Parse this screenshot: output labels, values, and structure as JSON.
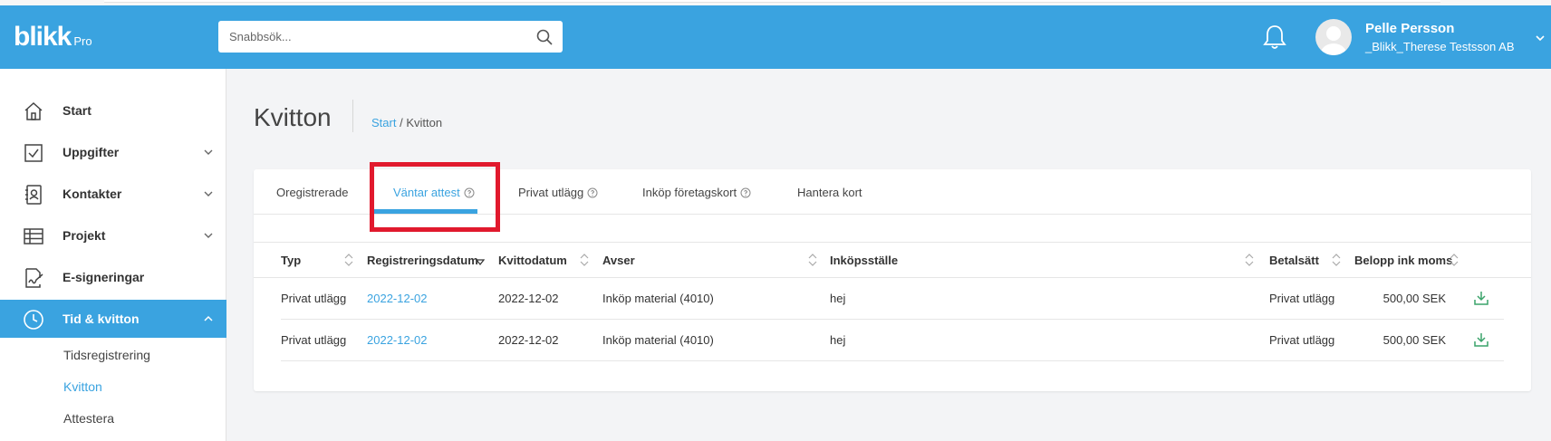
{
  "header": {
    "logo_text": "blikk",
    "logo_suffix": "Pro",
    "search_placeholder": "Snabbsök...",
    "user_name": "Pelle Persson",
    "user_company": "_Blikk_Therese Testsson AB"
  },
  "sidebar": {
    "items": [
      {
        "label": "Start",
        "icon": "home-icon"
      },
      {
        "label": "Uppgifter",
        "icon": "checkbox-icon"
      },
      {
        "label": "Kontakter",
        "icon": "contacts-icon"
      },
      {
        "label": "Projekt",
        "icon": "table-icon"
      },
      {
        "label": "E-signeringar",
        "icon": "signature-icon"
      },
      {
        "label": "Tid & kvitton",
        "icon": "clock-icon"
      }
    ],
    "sub_items": [
      {
        "label": "Tidsregistrering"
      },
      {
        "label": "Kvitton"
      },
      {
        "label": "Attestera"
      }
    ]
  },
  "page": {
    "title": "Kvitton",
    "breadcrumb_link": "Start",
    "breadcrumb_sep": "/",
    "breadcrumb_current": "Kvitton"
  },
  "tabs": [
    {
      "label": "Oregistrerade"
    },
    {
      "label": "Väntar attest"
    },
    {
      "label": "Privat utlägg"
    },
    {
      "label": "Inköp företagskort"
    },
    {
      "label": "Hantera kort"
    }
  ],
  "table": {
    "columns": [
      "Typ",
      "Registreringsdatum",
      "Kvittodatum",
      "Avser",
      "Inköpsställe",
      "Betalsätt",
      "Belopp ink moms"
    ],
    "rows": [
      {
        "typ": "Privat utlägg",
        "reg_date": "2022-12-02",
        "kvitto_date": "2022-12-02",
        "avser": "Inköp material (4010)",
        "inkopsstalle": "hej",
        "betalsatt": "Privat utlägg",
        "belopp": "500,00 SEK"
      },
      {
        "typ": "Privat utlägg",
        "reg_date": "2022-12-02",
        "kvitto_date": "2022-12-02",
        "avser": "Inköp material (4010)",
        "inkopsstalle": "hej",
        "betalsatt": "Privat utlägg",
        "belopp": "500,00 SEK"
      }
    ]
  },
  "colors": {
    "brand": "#3aa3e0",
    "highlight": "#e1192d",
    "download": "#3aa36a"
  }
}
